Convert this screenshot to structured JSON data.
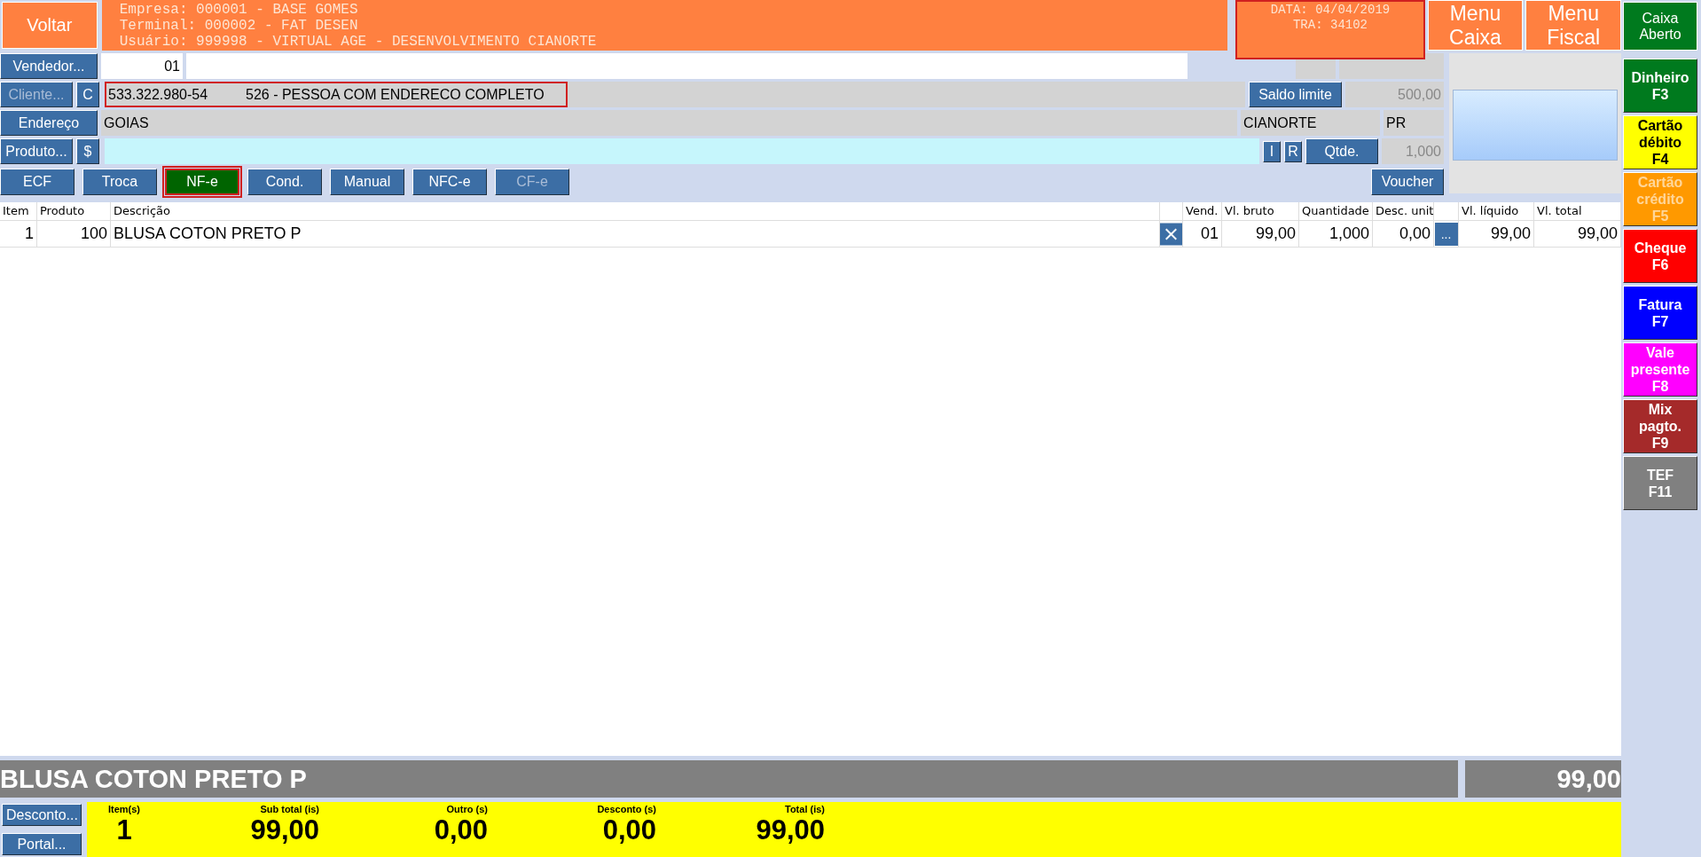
{
  "header": {
    "back_button": "Voltar",
    "info_lines": [
      "Empresa: 000001 - BASE GOMES",
      "Terminal: 000002 - FAT DESEN",
      "Usuário: 999998 - VIRTUAL AGE - DESENVOLVIMENTO CIANORTE"
    ],
    "date_box": {
      "lines": [
        "DATA: 04/04/2019",
        "TRA: 34102"
      ],
      "highlighted": true
    },
    "menu_buttons": [
      "Menu Caixa",
      "Menu Fiscal"
    ],
    "status_button": "Caixa Aberto"
  },
  "seller": {
    "button": "Vendedor...",
    "code": "01"
  },
  "client": {
    "button": "Cliente...",
    "button_disabled": true,
    "type_button": "C",
    "document": "533.322.980-54",
    "name": "526 - PESSOA COM ENDERECO COMPLETO",
    "highlighted": true,
    "limit_button": "Saldo limite",
    "limit_value": "500,00"
  },
  "address": {
    "button": "Endereço",
    "street": "GOIAS",
    "city": "CIANORTE",
    "state": "PR"
  },
  "product": {
    "button": "Produto...",
    "price_button": "$",
    "i_button": "I",
    "r_button": "R",
    "qty_button": "Qtde.",
    "qty_value": "1,000"
  },
  "doc_buttons": [
    {
      "label": "ECF",
      "selected": false,
      "disabled": false,
      "highlighted": false
    },
    {
      "label": "Troca",
      "selected": false,
      "disabled": false,
      "highlighted": false
    },
    {
      "label": "NF-e",
      "selected": true,
      "disabled": false,
      "highlighted": true
    },
    {
      "label": "Cond.",
      "selected": false,
      "disabled": false,
      "highlighted": false
    },
    {
      "label": "Manual",
      "selected": false,
      "disabled": false,
      "highlighted": false
    },
    {
      "label": "NFC-e",
      "selected": false,
      "disabled": false,
      "highlighted": false
    },
    {
      "label": "CF-e",
      "selected": false,
      "disabled": true,
      "highlighted": false
    }
  ],
  "voucher_button": "Voucher",
  "table": {
    "columns": [
      "Item",
      "Produto",
      "Descrição",
      "Vend.",
      "Vl. bruto",
      "Quantidade",
      "Desc. unit",
      "Vl. líquido",
      "Vl. total"
    ],
    "rows": [
      {
        "cells": [
          "1",
          "100",
          "BLUSA COTON PRETO P",
          "01",
          "99,00",
          "1,000",
          "0,00",
          "99,00",
          "99,00"
        ],
        "more_button": "..."
      }
    ]
  },
  "current_item": {
    "description": "BLUSA COTON PRETO P",
    "value": "99,00"
  },
  "side_buttons": [
    "Desconto...",
    "Portal..."
  ],
  "summary": [
    {
      "label": "Item(s)",
      "value": "1"
    },
    {
      "label": "Sub total (is)",
      "value": "99,00"
    },
    {
      "label": "Outro (s)",
      "value": "0,00"
    },
    {
      "label": "Desconto (s)",
      "value": "0,00"
    },
    {
      "label": "Total (is)",
      "value": "99,00"
    }
  ],
  "payments": [
    {
      "label": "Dinheiro",
      "key": "F3",
      "color": "#007a1e",
      "disabled": false
    },
    {
      "label": "Cartão débito",
      "key": "F4",
      "color": "#ffff00",
      "disabled": false
    },
    {
      "label": "Cartão crédito",
      "key": "F5",
      "color": "#ff9900",
      "disabled": true
    },
    {
      "label": "Cheque",
      "key": "F6",
      "color": "#ff0000",
      "disabled": false
    },
    {
      "label": "Fatura",
      "key": "F7",
      "color": "#0000ff",
      "disabled": false
    },
    {
      "label": "Vale presente",
      "key": "F8",
      "color": "#ff00ff",
      "disabled": false
    },
    {
      "label": "Mix pagto.",
      "key": "F9",
      "color": "#a52a2a",
      "disabled": false
    },
    {
      "label": "TEF",
      "key": "F11",
      "color": "#808080",
      "disabled": false
    }
  ]
}
